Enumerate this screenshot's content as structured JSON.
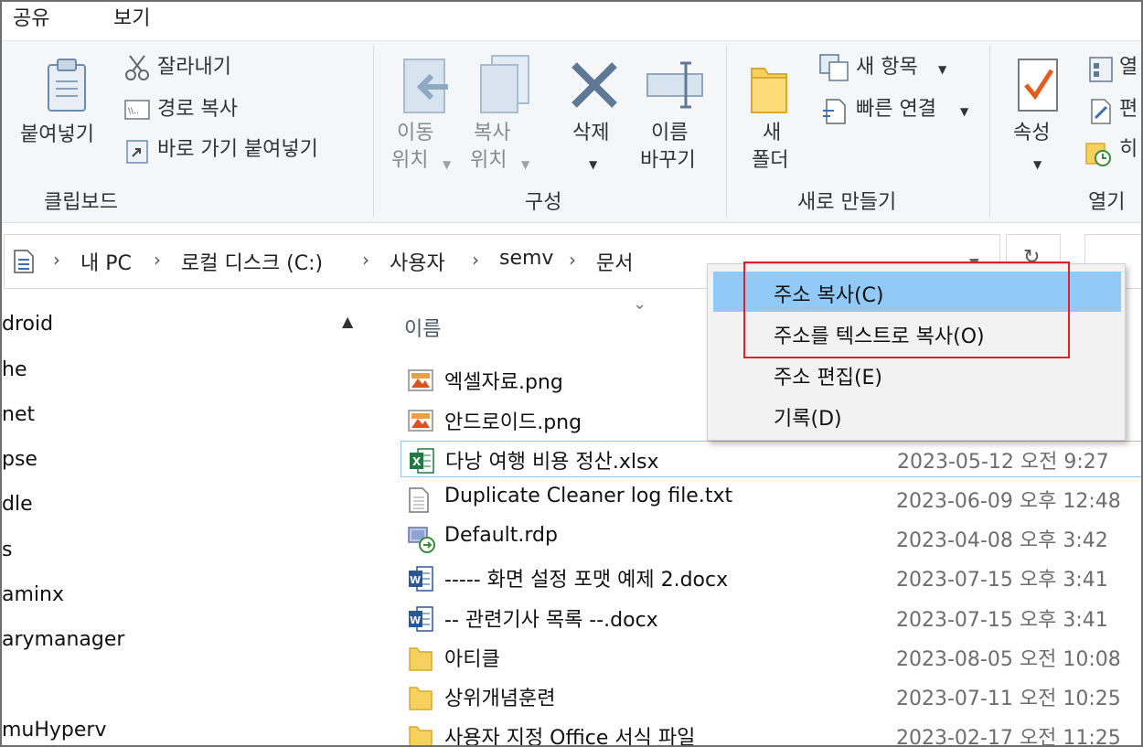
{
  "menu": {
    "tabs": [
      "공유",
      "보기"
    ]
  },
  "ribbon": {
    "clipboard": {
      "group_label": "클립보드",
      "paste_label": "붙여넣기",
      "cut_label": "잘라내기",
      "copy_path_label": "경로 복사",
      "paste_shortcut_label": "바로 가기 붙여넣기"
    },
    "organize": {
      "group_label": "구성",
      "move_to_line1": "이동",
      "move_to_line2": "위치",
      "copy_to_line1": "복사",
      "copy_to_line2": "위치",
      "delete_label": "삭제",
      "rename_line1": "이름",
      "rename_line2": "바꾸기"
    },
    "new": {
      "group_label": "새로 만들기",
      "new_folder_line1": "새",
      "new_folder_line2": "폴더",
      "new_item_label": "새 항목",
      "easy_access_label": "빠른 연결"
    },
    "open": {
      "group_label": "열기",
      "properties_label": "속성",
      "open_label": "열",
      "edit_label": "편",
      "history_label": "히"
    }
  },
  "address": {
    "crumbs": [
      "내 PC",
      "로컬 디스크 (C:)",
      "사용자",
      "semv",
      "문서"
    ]
  },
  "nav": {
    "items": [
      "droid",
      "he",
      "net",
      "pse",
      "dle",
      "s",
      "aminx",
      "arymanager",
      "",
      "muHyperv"
    ]
  },
  "filelist": {
    "column_name": "이름",
    "files": [
      {
        "name": "엑셀자료.png",
        "date": "",
        "icon": "image-icon"
      },
      {
        "name": "안드로이드.png",
        "date": "",
        "icon": "image-icon"
      },
      {
        "name": "다낭 여행 비용 정산.xlsx",
        "date": "2023-05-12 오전 9:27",
        "icon": "excel-icon"
      },
      {
        "name": "Duplicate Cleaner log file.txt",
        "date": "2023-06-09 오후 12:48",
        "icon": "text-file-icon"
      },
      {
        "name": "Default.rdp",
        "date": "2023-04-08 오후 3:42",
        "icon": "rdp-icon"
      },
      {
        "name": "----- 화면 설정 포맷 예제 2.docx",
        "date": "2023-07-15 오후 3:41",
        "icon": "word-icon"
      },
      {
        "name": "-- 관련기사 목록 --.docx",
        "date": "2023-07-15 오후 3:41",
        "icon": "word-icon"
      },
      {
        "name": "아티클",
        "date": "2023-08-05 오전 10:08",
        "icon": "folder-icon"
      },
      {
        "name": "상위개념훈련",
        "date": "2023-07-11 오전 10:25",
        "icon": "folder-icon"
      },
      {
        "name": "사용자 지정 Office 서식 파일",
        "date": "2023-02-17 오전 11:25",
        "icon": "folder-icon"
      }
    ]
  },
  "context_menu": {
    "items": [
      "주소 복사(C)",
      "주소를 텍스트로 복사(O)",
      "주소 편집(E)",
      "기록(D)"
    ]
  },
  "colors": {
    "ribbon_bg": "#f5f6f7",
    "menu_hover": "#91c9f7",
    "highlight_red": "#e0202a",
    "selection_border": "#99c4ee"
  }
}
